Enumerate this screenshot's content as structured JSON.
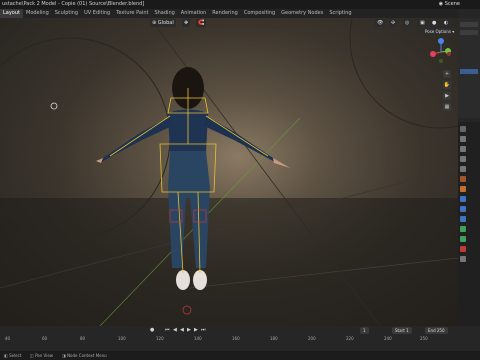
{
  "window": {
    "title": "ustache\\Pack 2 Model - Copie (01) Source\\Blender.blend]"
  },
  "header": {
    "tabs": [
      "Layout",
      "Modeling",
      "Sculpting",
      "UV Editing",
      "Texture Paint",
      "Shading",
      "Animation",
      "Rendering",
      "Compositing",
      "Geometry Nodes",
      "Scripting"
    ],
    "active_tab": "Layout",
    "scene_label": "Scene"
  },
  "viewport": {
    "mode_label": "Global",
    "pose_options_label": "Pose Options",
    "gizmo_axes": [
      "X",
      "Y",
      "Z"
    ],
    "axis_colors": {
      "x": "#e0435a",
      "y": "#79c13f",
      "z": "#4a86e8"
    }
  },
  "timeline": {
    "current_frame": "1",
    "start_label": "Start",
    "start_value": "1",
    "end_label": "End",
    "end_value": "250",
    "ruler_ticks": [
      "40",
      "60",
      "80",
      "100",
      "120",
      "140",
      "160",
      "180",
      "200",
      "220",
      "240",
      "250"
    ]
  },
  "status_bar": {
    "items": [
      "Select",
      "Pan View",
      "Node Context Menu"
    ]
  }
}
